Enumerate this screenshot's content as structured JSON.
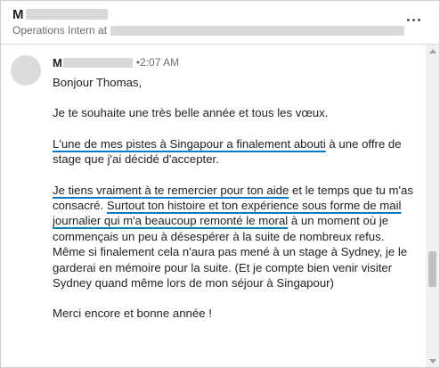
{
  "header": {
    "initial": "M",
    "subtitle_prefix": "Operations Intern at"
  },
  "message": {
    "sender_initial": "M",
    "separator": " • ",
    "time": "2:07 AM",
    "greeting": "Bonjour Thomas,",
    "para1": "Je te souhaite une très belle année et tous les vœux.",
    "para2_u": "L'une de mes pistes à Singapour a finalement abouti",
    "para2_rest": " à une offre de stage que j'ai décidé d'accepter.",
    "para3_u1": "Je tiens vraiment à te remercier pour ton aide",
    "para3_mid": " et le temps que tu m'as consacré. ",
    "para3_u2": "Surtout ton histoire et ton expérience sous forme de mail journalier qui m'a beaucoup remonté le moral",
    "para3_rest": " à un moment où je commençais un peu à désespérer à la suite de nombreux refus. Même si finalement cela n'aura pas mené à un stage à Sydney, je le garderai en mémoire pour la suite. (Et je compte bien venir visiter Sydney quand même lors de mon séjour à Singapour)",
    "closing": "Merci encore et bonne année !"
  },
  "colors": {
    "underline": "#0a7cc1",
    "redaction": "#d9d9d9"
  },
  "icons": {
    "more": "more-horizontal-icon"
  }
}
